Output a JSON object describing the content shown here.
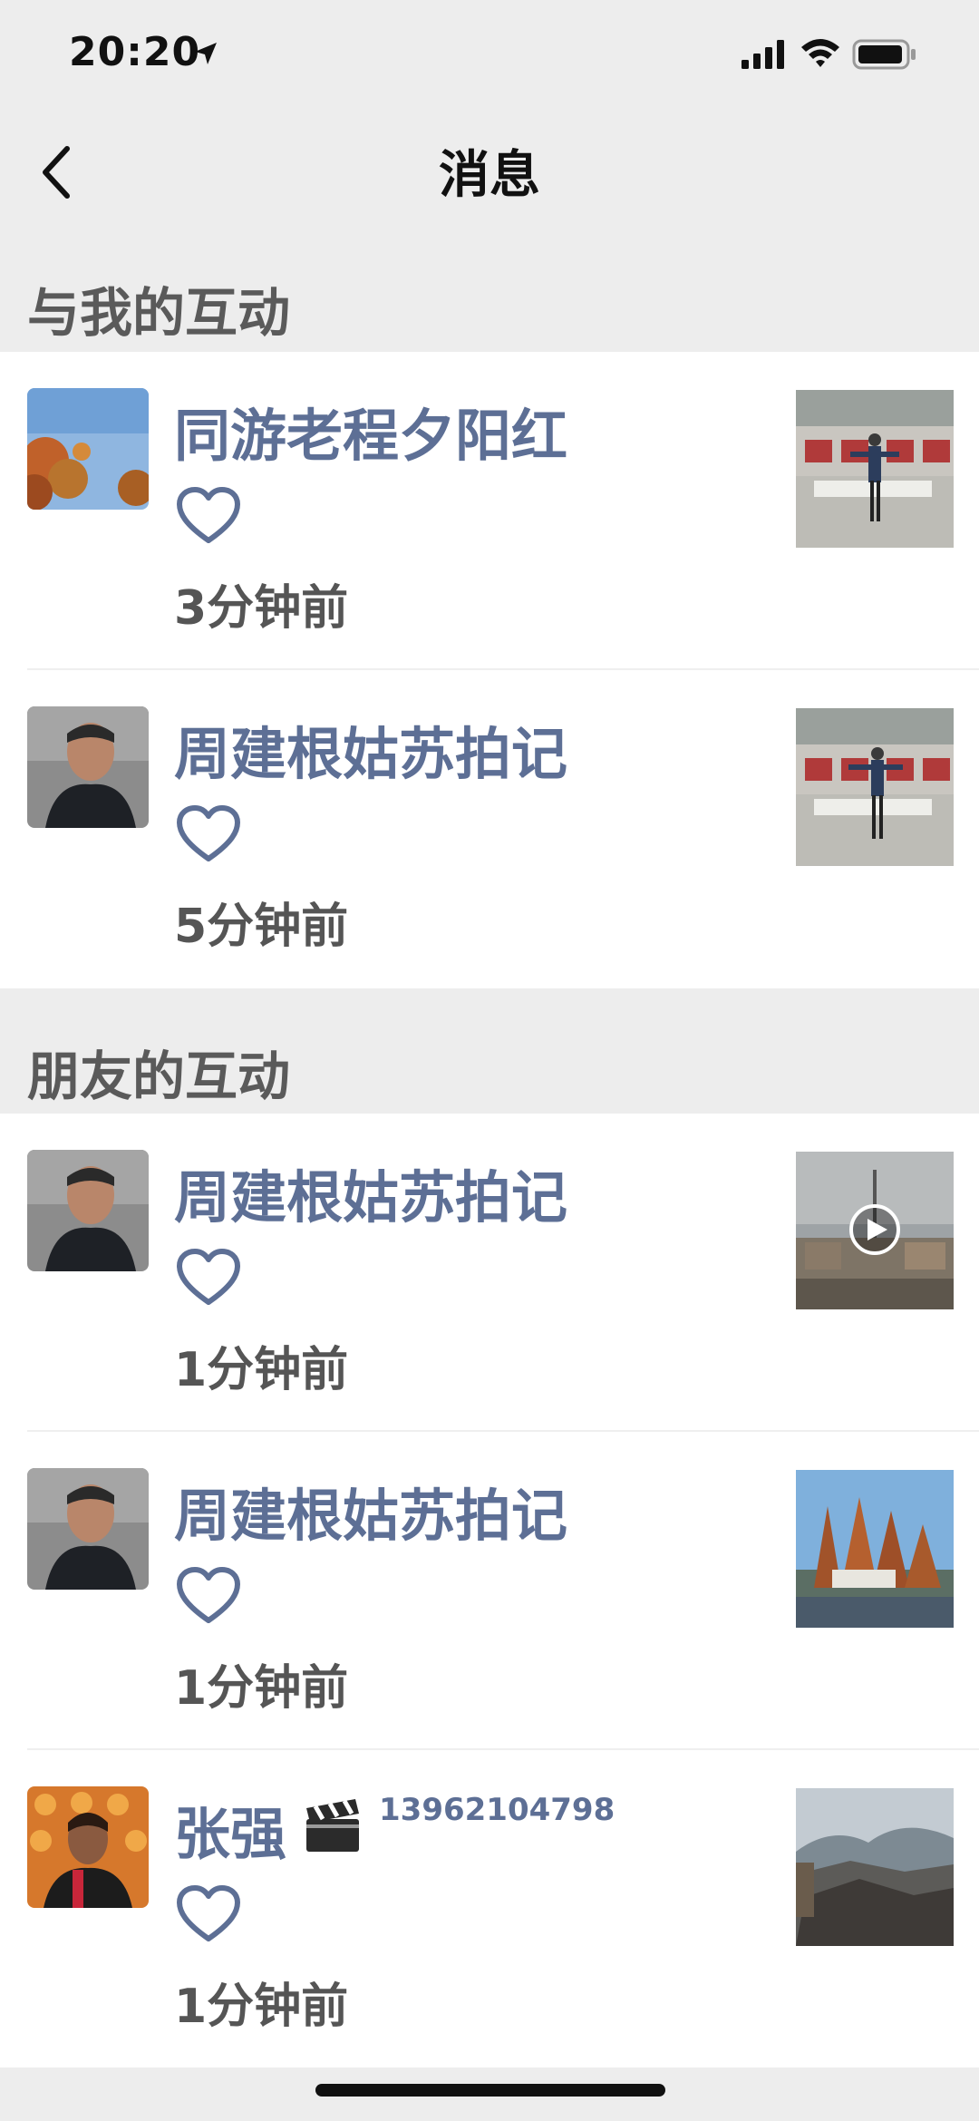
{
  "status_bar": {
    "time": "20:20"
  },
  "nav": {
    "title": "消息"
  },
  "sections": [
    {
      "title": "与我的互动",
      "items": [
        {
          "name": "同游老程夕阳红",
          "time": "3分钟前"
        },
        {
          "name": "周建根姑苏拍记",
          "time": "5分钟前"
        }
      ]
    },
    {
      "title": "朋友的互动",
      "items": [
        {
          "name": "周建根姑苏拍记",
          "time": "1分钟前"
        },
        {
          "name": "周建根姑苏拍记",
          "time": "1分钟前"
        },
        {
          "name": "张强",
          "phone": "13962104798",
          "time": "1分钟前"
        }
      ]
    }
  ],
  "icons": {
    "back": "chevron-left-icon",
    "like": "heart-outline-icon",
    "clapper": "clapperboard-icon",
    "play": "play-icon"
  },
  "colors": {
    "name_link": "#5d6f95",
    "heart_stroke": "#5d6f95",
    "background": "#ededed"
  }
}
